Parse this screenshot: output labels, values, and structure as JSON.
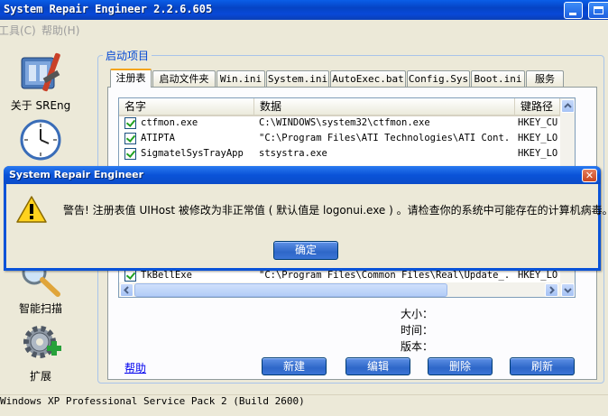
{
  "window": {
    "title": "System Repair Engineer 2.2.6.605"
  },
  "menu": {
    "items": [
      "工具(C)",
      "帮助(H)"
    ]
  },
  "nav": {
    "items": [
      {
        "label": "关于 SREng",
        "icon": "toolbox-icon"
      },
      {
        "label": "",
        "icon": "clock-icon"
      },
      {
        "label": "智能扫描",
        "icon": "magnifier-icon"
      },
      {
        "label": "扩展",
        "icon": "gear-plus-icon"
      }
    ]
  },
  "group": {
    "title": "启动项目"
  },
  "tabs": [
    "注册表",
    "启动文件夹",
    "Win.ini",
    "System.ini",
    "AutoExec.bat",
    "Config.Sys",
    "Boot.ini",
    "服务"
  ],
  "list": {
    "columns": [
      "名字",
      "数据",
      "键路径"
    ],
    "rows": [
      {
        "name": "ctfmon.exe",
        "data": "C:\\WINDOWS\\system32\\ctfmon.exe",
        "key": "HKEY_CU"
      },
      {
        "name": "ATIPTA",
        "data": "\"C:\\Program Files\\ATI Technologies\\ATI Cont...",
        "key": "HKEY_LO"
      },
      {
        "name": "SigmatelSysTrayApp",
        "data": "stsystra.exe",
        "key": "HKEY_LO"
      },
      {
        "name": "TkBellExe",
        "data": "\"C:\\Program Files\\Common Files\\Real\\Update_...",
        "key": "HKEY_LO"
      }
    ]
  },
  "info": {
    "size_label": "大小：",
    "time_label": "时间：",
    "version_label": "版本："
  },
  "buttons": {
    "help": "帮助",
    "new": "新建",
    "edit": "编辑",
    "delete": "删除",
    "refresh": "刷新"
  },
  "status": {
    "text": "Windows XP Professional Service Pack 2 (Build 2600)"
  },
  "dialog": {
    "title": "System Repair Engineer",
    "message": "警告! 注册表值 UIHost 被修改为非正常值 ( 默认值是 logonui.exe ) 。请检查你的系统中可能存在的计算机病毒。",
    "ok": "确定",
    "icon": "warning-icon"
  },
  "colors": {
    "titlebar": "#0a5ee8",
    "accent_tab": "#f5a41a",
    "button": "#2e67c8"
  }
}
